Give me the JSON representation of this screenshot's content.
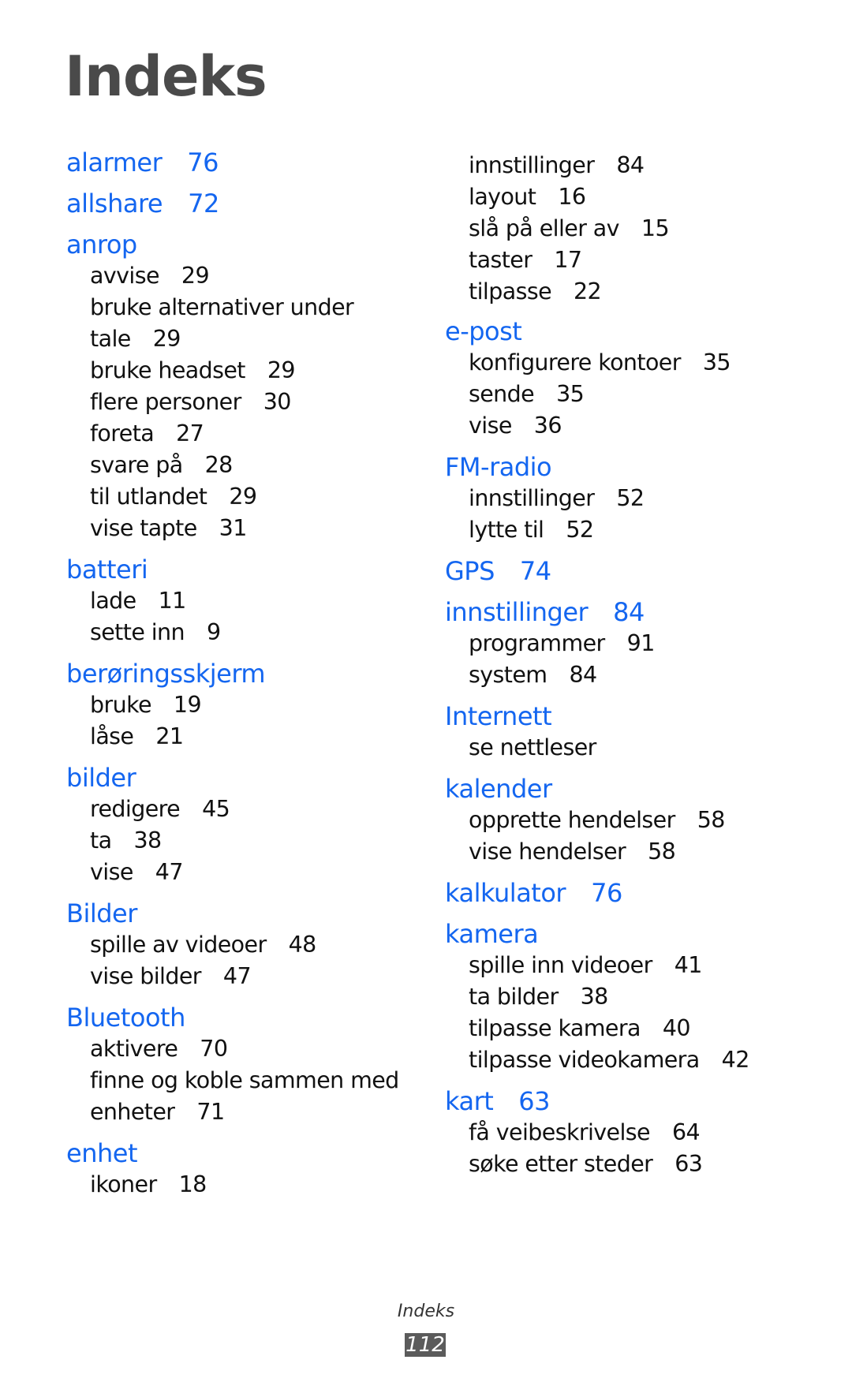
{
  "page_title": "Indeks",
  "colors": {
    "heading": "#1466f0",
    "text": "#111111",
    "title": "#4a4a4a",
    "badge": "#5b5b5b"
  },
  "left_column": [
    {
      "term": "alarmer",
      "page": "76",
      "subs": []
    },
    {
      "term": "allshare",
      "page": "72",
      "subs": []
    },
    {
      "term": "anrop",
      "page": "",
      "subs": [
        {
          "text": "avvise",
          "page": "29"
        },
        {
          "text": "bruke alternativer under",
          "page": ""
        },
        {
          "text": "tale",
          "page": "29"
        },
        {
          "text": "bruke headset",
          "page": "29"
        },
        {
          "text": "flere personer",
          "page": "30"
        },
        {
          "text": "foreta",
          "page": "27"
        },
        {
          "text": "svare på",
          "page": "28"
        },
        {
          "text": "til utlandet",
          "page": "29"
        },
        {
          "text": "vise tapte",
          "page": "31"
        }
      ]
    },
    {
      "term": "batteri",
      "page": "",
      "subs": [
        {
          "text": "lade",
          "page": "11"
        },
        {
          "text": "sette inn",
          "page": "9"
        }
      ]
    },
    {
      "term": "berøringsskjerm",
      "page": "",
      "subs": [
        {
          "text": "bruke",
          "page": "19"
        },
        {
          "text": "låse",
          "page": "21"
        }
      ]
    },
    {
      "term": "bilder",
      "page": "",
      "subs": [
        {
          "text": "redigere",
          "page": "45"
        },
        {
          "text": "ta",
          "page": "38"
        },
        {
          "text": "vise",
          "page": "47"
        }
      ]
    },
    {
      "term": "Bilder",
      "page": "",
      "subs": [
        {
          "text": "spille av videoer",
          "page": "48"
        },
        {
          "text": "vise bilder",
          "page": "47"
        }
      ]
    },
    {
      "term": "Bluetooth",
      "page": "",
      "subs": [
        {
          "text": "aktivere",
          "page": "70"
        },
        {
          "text": "finne og koble sammen med",
          "page": ""
        },
        {
          "text": "enheter",
          "page": "71"
        }
      ]
    },
    {
      "term": "enhet",
      "page": "",
      "subs": [
        {
          "text": "ikoner",
          "page": "18"
        }
      ]
    }
  ],
  "right_column_continuation": [
    {
      "text": "innstillinger",
      "page": "84"
    },
    {
      "text": "layout",
      "page": "16"
    },
    {
      "text": "slå på eller av",
      "page": "15"
    },
    {
      "text": "taster",
      "page": "17"
    },
    {
      "text": "tilpasse",
      "page": "22"
    }
  ],
  "right_column": [
    {
      "term": "e-post",
      "page": "",
      "subs": [
        {
          "text": "konfigurere kontoer",
          "page": "35"
        },
        {
          "text": "sende",
          "page": "35"
        },
        {
          "text": "vise",
          "page": "36"
        }
      ]
    },
    {
      "term": "FM-radio",
      "page": "",
      "subs": [
        {
          "text": "innstillinger",
          "page": "52"
        },
        {
          "text": "lytte til",
          "page": "52"
        }
      ]
    },
    {
      "term": "GPS",
      "page": "74",
      "subs": []
    },
    {
      "term": "innstillinger",
      "page": "84",
      "subs": [
        {
          "text": "programmer",
          "page": "91"
        },
        {
          "text": "system",
          "page": "84"
        }
      ]
    },
    {
      "term": "Internett",
      "page": "",
      "subs": [
        {
          "text": "se nettleser",
          "page": ""
        }
      ]
    },
    {
      "term": "kalender",
      "page": "",
      "subs": [
        {
          "text": "opprette hendelser",
          "page": "58"
        },
        {
          "text": "vise hendelser",
          "page": "58"
        }
      ]
    },
    {
      "term": "kalkulator",
      "page": "76",
      "subs": []
    },
    {
      "term": "kamera",
      "page": "",
      "subs": [
        {
          "text": "spille inn videoer",
          "page": "41"
        },
        {
          "text": "ta bilder",
          "page": "38"
        },
        {
          "text": "tilpasse kamera",
          "page": "40"
        },
        {
          "text": "tilpasse videokamera",
          "page": "42"
        }
      ]
    },
    {
      "term": "kart",
      "page": "63",
      "subs": [
        {
          "text": "få veibeskrivelse",
          "page": "64"
        },
        {
          "text": "søke etter steder",
          "page": "63"
        }
      ]
    }
  ],
  "footer": {
    "section_label": "Indeks",
    "page_number": "112"
  }
}
